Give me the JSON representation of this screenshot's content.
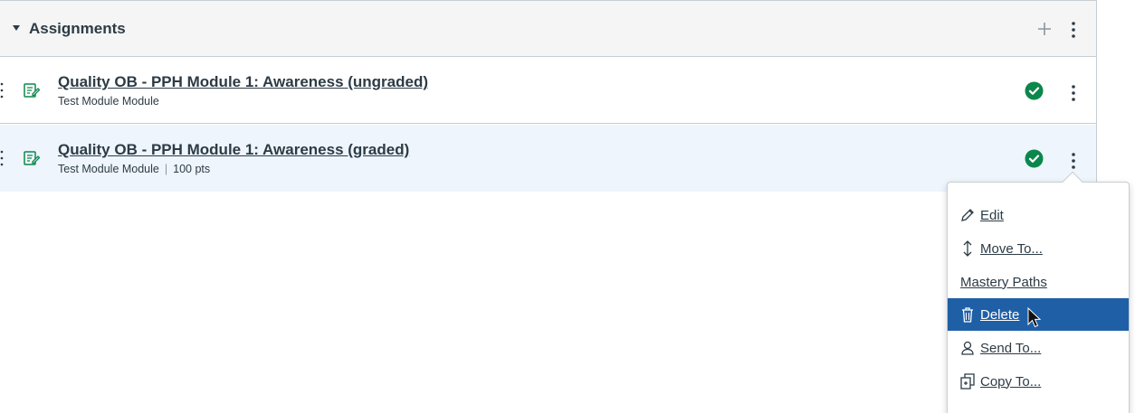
{
  "module": {
    "title": "Assignments",
    "header_icons": [
      "add-icon",
      "kebab-menu-icon"
    ]
  },
  "items": [
    {
      "title": "Quality OB - PPH Module 1: Awareness (ungraded)",
      "module_name": "Test Module Module",
      "points": "",
      "status_icon": "published-check-icon"
    },
    {
      "title": "Quality OB - PPH Module 1: Awareness (graded)",
      "module_name": "Test Module Module",
      "separator": "|",
      "points": "100 pts",
      "status_icon": "published-check-icon"
    }
  ],
  "menu": {
    "items": [
      {
        "label": "Edit",
        "icon": "pencil-icon"
      },
      {
        "label": "Move To...",
        "icon": "move-arrows-icon"
      },
      {
        "label": "Mastery Paths",
        "icon": ""
      },
      {
        "label": "Delete",
        "icon": "trash-icon",
        "active": true
      },
      {
        "label": "Send To...",
        "icon": "user-icon"
      },
      {
        "label": "Copy To...",
        "icon": "copy-icon"
      }
    ]
  },
  "colors": {
    "header_bg": "#f5f5f5",
    "highlight_row": "#eef5fc",
    "published_green": "#0b874b",
    "menu_active": "#1f5fa6",
    "text": "#2d3b45",
    "border": "#c7cdd1"
  }
}
